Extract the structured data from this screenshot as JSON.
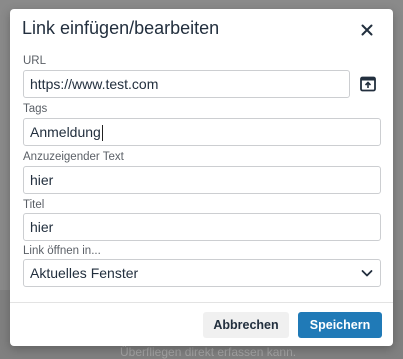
{
  "background": {
    "hint_text": "Überfliegen direkt erfassen kann."
  },
  "dialog": {
    "title": "Link einfügen/bearbeiten",
    "fields": {
      "url": {
        "label": "URL",
        "value": "https://www.test.com"
      },
      "tags": {
        "label": "Tags",
        "value": "Anmeldung"
      },
      "display_text": {
        "label": "Anzuzeigender Text",
        "value": "hier"
      },
      "title": {
        "label": "Titel",
        "value": "hier"
      },
      "open_in": {
        "label": "Link öffnen in...",
        "selected": "Aktuelles Fenster"
      }
    },
    "buttons": {
      "cancel": "Abbrechen",
      "save": "Speichern"
    }
  },
  "colors": {
    "primary": "#207ab7",
    "text": "#222f3e",
    "border": "#ccced1"
  }
}
